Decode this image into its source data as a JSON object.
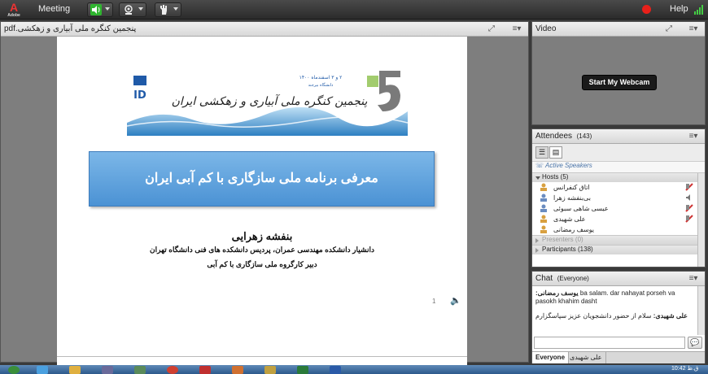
{
  "topbar": {
    "logo_text": "Adobe",
    "menu_meeting": "Meeting",
    "help": "Help",
    "icons": [
      "speaker-icon",
      "webcam-icon",
      "raise-hand-icon",
      "record-icon",
      "signal-icon"
    ],
    "speaker_on_color": "#2fb52f",
    "record_color": "#e8201a"
  },
  "share": {
    "filename": "پنجمین کنگره ملی آبیاری و زهکشی.pdf",
    "banner": {
      "congress_title": "پنجمین کنگره ملی آبیاری و زهکشی ایران",
      "date_line": "۲ و ۳ اسفندماه ۱۴۰۰",
      "university_line": "دانشگاه بیرجند",
      "logo_letters": "ID"
    },
    "slide_title": "معرفی برنامه ملی سازگاری با کم آبی ایران",
    "author_name": "بنفشه زهرایی",
    "author_affiliation": "دانشیار دانشکده مهندسی عمران، پردیس دانشکده های فنی دانشگاه تهران",
    "author_role": "دبیر کارگروه ملی سازگاری با کم آبی",
    "page_indicator": "1",
    "title_bg_color": "#5fa3df"
  },
  "video": {
    "title": "Video",
    "webcam_button": "Start My Webcam"
  },
  "attendees": {
    "title": "Attendees",
    "count": "(143)",
    "active_speakers": "Active Speakers",
    "hosts_label": "Hosts (5)",
    "presenters_label": "Presenters (0)",
    "participants_label": "Participants (138)",
    "hosts": [
      {
        "name": "اتاق کنفرانس"
      },
      {
        "name": "بی‌بنفشه زهرا"
      },
      {
        "name": "عیسی شاهی سبوئی"
      },
      {
        "name": "علی شهیدی"
      },
      {
        "name": "یوسف رمضانی"
      }
    ]
  },
  "chat": {
    "title": "Chat",
    "audience": "(Everyone)",
    "messages": [
      {
        "sender": "یوسف رمضانی:",
        "text": "ba salam. dar nahayat porseh va pasokh khahim dasht"
      },
      {
        "sender": "علی شهیدی:",
        "text": "سلام از حضور دانشجویان عزیز سپاسگزارم"
      }
    ],
    "tabs": [
      "Everyone",
      "علی شهیدی"
    ]
  },
  "taskbar": {
    "clock": "10:42 ق.ظ"
  }
}
